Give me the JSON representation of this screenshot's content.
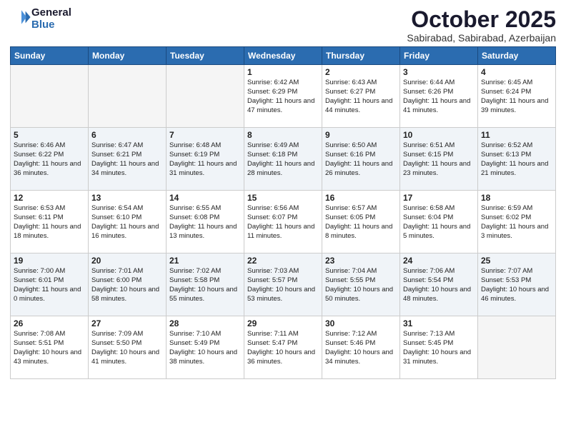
{
  "logo": {
    "line1": "General",
    "line2": "Blue"
  },
  "header": {
    "month": "October 2025",
    "location": "Sabirabad, Sabirabad, Azerbaijan"
  },
  "weekdays": [
    "Sunday",
    "Monday",
    "Tuesday",
    "Wednesday",
    "Thursday",
    "Friday",
    "Saturday"
  ],
  "weeks": [
    [
      {
        "day": "",
        "info": ""
      },
      {
        "day": "",
        "info": ""
      },
      {
        "day": "",
        "info": ""
      },
      {
        "day": "1",
        "info": "Sunrise: 6:42 AM\nSunset: 6:29 PM\nDaylight: 11 hours\nand 47 minutes."
      },
      {
        "day": "2",
        "info": "Sunrise: 6:43 AM\nSunset: 6:27 PM\nDaylight: 11 hours\nand 44 minutes."
      },
      {
        "day": "3",
        "info": "Sunrise: 6:44 AM\nSunset: 6:26 PM\nDaylight: 11 hours\nand 41 minutes."
      },
      {
        "day": "4",
        "info": "Sunrise: 6:45 AM\nSunset: 6:24 PM\nDaylight: 11 hours\nand 39 minutes."
      }
    ],
    [
      {
        "day": "5",
        "info": "Sunrise: 6:46 AM\nSunset: 6:22 PM\nDaylight: 11 hours\nand 36 minutes."
      },
      {
        "day": "6",
        "info": "Sunrise: 6:47 AM\nSunset: 6:21 PM\nDaylight: 11 hours\nand 34 minutes."
      },
      {
        "day": "7",
        "info": "Sunrise: 6:48 AM\nSunset: 6:19 PM\nDaylight: 11 hours\nand 31 minutes."
      },
      {
        "day": "8",
        "info": "Sunrise: 6:49 AM\nSunset: 6:18 PM\nDaylight: 11 hours\nand 28 minutes."
      },
      {
        "day": "9",
        "info": "Sunrise: 6:50 AM\nSunset: 6:16 PM\nDaylight: 11 hours\nand 26 minutes."
      },
      {
        "day": "10",
        "info": "Sunrise: 6:51 AM\nSunset: 6:15 PM\nDaylight: 11 hours\nand 23 minutes."
      },
      {
        "day": "11",
        "info": "Sunrise: 6:52 AM\nSunset: 6:13 PM\nDaylight: 11 hours\nand 21 minutes."
      }
    ],
    [
      {
        "day": "12",
        "info": "Sunrise: 6:53 AM\nSunset: 6:11 PM\nDaylight: 11 hours\nand 18 minutes."
      },
      {
        "day": "13",
        "info": "Sunrise: 6:54 AM\nSunset: 6:10 PM\nDaylight: 11 hours\nand 16 minutes."
      },
      {
        "day": "14",
        "info": "Sunrise: 6:55 AM\nSunset: 6:08 PM\nDaylight: 11 hours\nand 13 minutes."
      },
      {
        "day": "15",
        "info": "Sunrise: 6:56 AM\nSunset: 6:07 PM\nDaylight: 11 hours\nand 11 minutes."
      },
      {
        "day": "16",
        "info": "Sunrise: 6:57 AM\nSunset: 6:05 PM\nDaylight: 11 hours\nand 8 minutes."
      },
      {
        "day": "17",
        "info": "Sunrise: 6:58 AM\nSunset: 6:04 PM\nDaylight: 11 hours\nand 5 minutes."
      },
      {
        "day": "18",
        "info": "Sunrise: 6:59 AM\nSunset: 6:02 PM\nDaylight: 11 hours\nand 3 minutes."
      }
    ],
    [
      {
        "day": "19",
        "info": "Sunrise: 7:00 AM\nSunset: 6:01 PM\nDaylight: 11 hours\nand 0 minutes."
      },
      {
        "day": "20",
        "info": "Sunrise: 7:01 AM\nSunset: 6:00 PM\nDaylight: 10 hours\nand 58 minutes."
      },
      {
        "day": "21",
        "info": "Sunrise: 7:02 AM\nSunset: 5:58 PM\nDaylight: 10 hours\nand 55 minutes."
      },
      {
        "day": "22",
        "info": "Sunrise: 7:03 AM\nSunset: 5:57 PM\nDaylight: 10 hours\nand 53 minutes."
      },
      {
        "day": "23",
        "info": "Sunrise: 7:04 AM\nSunset: 5:55 PM\nDaylight: 10 hours\nand 50 minutes."
      },
      {
        "day": "24",
        "info": "Sunrise: 7:06 AM\nSunset: 5:54 PM\nDaylight: 10 hours\nand 48 minutes."
      },
      {
        "day": "25",
        "info": "Sunrise: 7:07 AM\nSunset: 5:53 PM\nDaylight: 10 hours\nand 46 minutes."
      }
    ],
    [
      {
        "day": "26",
        "info": "Sunrise: 7:08 AM\nSunset: 5:51 PM\nDaylight: 10 hours\nand 43 minutes."
      },
      {
        "day": "27",
        "info": "Sunrise: 7:09 AM\nSunset: 5:50 PM\nDaylight: 10 hours\nand 41 minutes."
      },
      {
        "day": "28",
        "info": "Sunrise: 7:10 AM\nSunset: 5:49 PM\nDaylight: 10 hours\nand 38 minutes."
      },
      {
        "day": "29",
        "info": "Sunrise: 7:11 AM\nSunset: 5:47 PM\nDaylight: 10 hours\nand 36 minutes."
      },
      {
        "day": "30",
        "info": "Sunrise: 7:12 AM\nSunset: 5:46 PM\nDaylight: 10 hours\nand 34 minutes."
      },
      {
        "day": "31",
        "info": "Sunrise: 7:13 AM\nSunset: 5:45 PM\nDaylight: 10 hours\nand 31 minutes."
      },
      {
        "day": "",
        "info": ""
      }
    ]
  ]
}
